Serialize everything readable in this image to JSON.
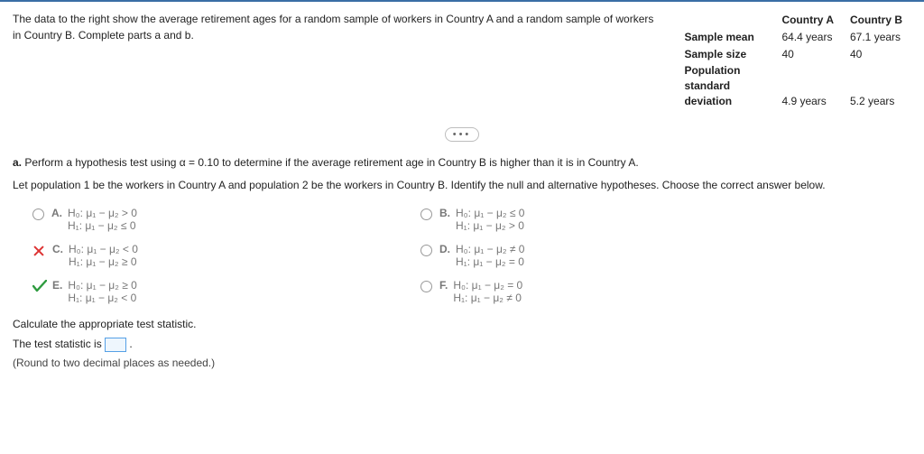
{
  "prompt": "The data to the right show the average retirement ages for a random sample of workers in Country A and a random sample of workers in Country B. Complete parts a and b.",
  "table": {
    "col1_header": "Country A",
    "col2_header": "Country B",
    "rows": [
      {
        "label": "Sample mean",
        "a": "64.4 years",
        "b": "67.1 years"
      },
      {
        "label": "Sample size",
        "a": "40",
        "b": "40"
      },
      {
        "label": "Population standard deviation",
        "a": "4.9 years",
        "b": "5.2 years"
      }
    ]
  },
  "partA": {
    "intro_bold": "a.",
    "intro": "Perform a hypothesis test using α = 0.10 to determine if the average retirement age in Country B is higher than it is in Country A.",
    "sub": "Let population 1 be the workers in Country A and population 2 be the workers in Country B. Identify the null and alternative hypotheses. Choose the correct answer below."
  },
  "options": {
    "A": {
      "h0": "H₀: μ₁ − μ₂ > 0",
      "h1": "H₁: μ₁ − μ₂ ≤ 0",
      "status": "none"
    },
    "B": {
      "h0": "H₀: μ₁ − μ₂ ≤ 0",
      "h1": "H₁: μ₁ − μ₂ > 0",
      "status": "none"
    },
    "C": {
      "h0": "H₀: μ₁ − μ₂ < 0",
      "h1": "H₁: μ₁ − μ₂ ≥ 0",
      "status": "wrong"
    },
    "D": {
      "h0": "H₀: μ₁ − μ₂ ≠ 0",
      "h1": "H₁: μ₁ − μ₂ = 0",
      "status": "none"
    },
    "E": {
      "h0": "H₀: μ₁ − μ₂ ≥ 0",
      "h1": "H₁: μ₁ − μ₂ < 0",
      "status": "correct"
    },
    "F": {
      "h0": "H₀: μ₁ − μ₂ = 0",
      "h1": "H₁: μ₁ − μ₂ ≠ 0",
      "status": "none"
    }
  },
  "calc": {
    "heading": "Calculate the appropriate test statistic.",
    "line_prefix": "The test statistic is ",
    "line_suffix": ".",
    "note": "(Round to two decimal places as needed.)"
  },
  "letters": {
    "A": "A.",
    "B": "B.",
    "C": "C.",
    "D": "D.",
    "E": "E.",
    "F": "F."
  }
}
